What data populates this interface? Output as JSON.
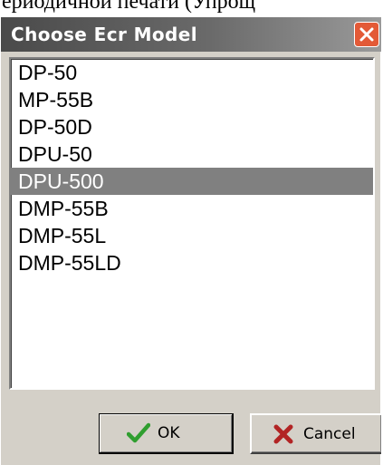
{
  "top_fragment": "ериодичнои печати (Упрощ",
  "dialog": {
    "title": "Choose Ecr Model"
  },
  "models": [
    {
      "label": "DP-50",
      "selected": false
    },
    {
      "label": "MP-55B",
      "selected": false
    },
    {
      "label": "DP-50D",
      "selected": false
    },
    {
      "label": "DPU-50",
      "selected": false
    },
    {
      "label": "DPU-500",
      "selected": true
    },
    {
      "label": "DMP-55B",
      "selected": false
    },
    {
      "label": "DMP-55L",
      "selected": false
    },
    {
      "label": "DMP-55LD",
      "selected": false
    }
  ],
  "buttons": {
    "ok_label": "OK",
    "cancel_label": "Cancel"
  },
  "icons": {
    "close": "close-icon",
    "ok": "checkmark-icon",
    "cancel": "cross-icon"
  },
  "colors": {
    "titlebar": "#5a5a5a",
    "close_button": "#e35a37",
    "selection": "#808080",
    "dialog_face": "#d4d0c8",
    "ok_check": "#2f9e2f",
    "cancel_cross": "#b22424"
  }
}
